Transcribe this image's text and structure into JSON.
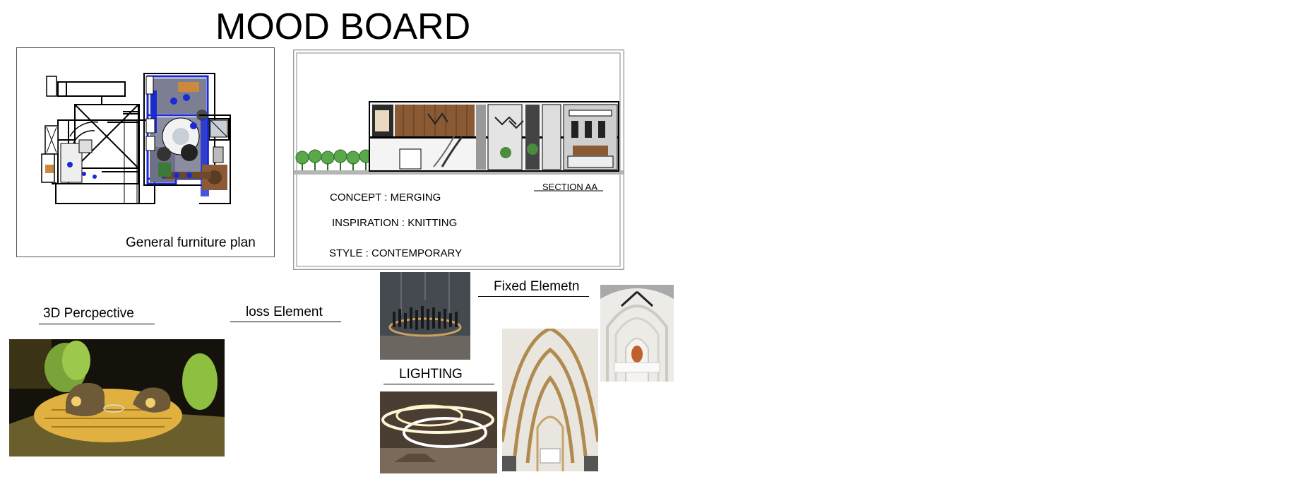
{
  "board": {
    "title": "MOOD BOARD"
  },
  "plan": {
    "caption": "General furniture plan"
  },
  "section": {
    "label": "SECTION AA",
    "concept": "CONCEPT : MERGING",
    "inspiration": "INSPIRATION : KNITTING",
    "style": "STYLE : CONTEMPORARY"
  },
  "labels": {
    "perspective": "3D Percpective",
    "loose": "loss Element",
    "fixed": "Fixed Elemetn",
    "lighting": "LIGHTING"
  },
  "colors": {
    "plan_blue": "#1a2bd6",
    "wood": "#8a5a34",
    "greenery": "#5aa84a",
    "gold": "#b08a4e"
  }
}
